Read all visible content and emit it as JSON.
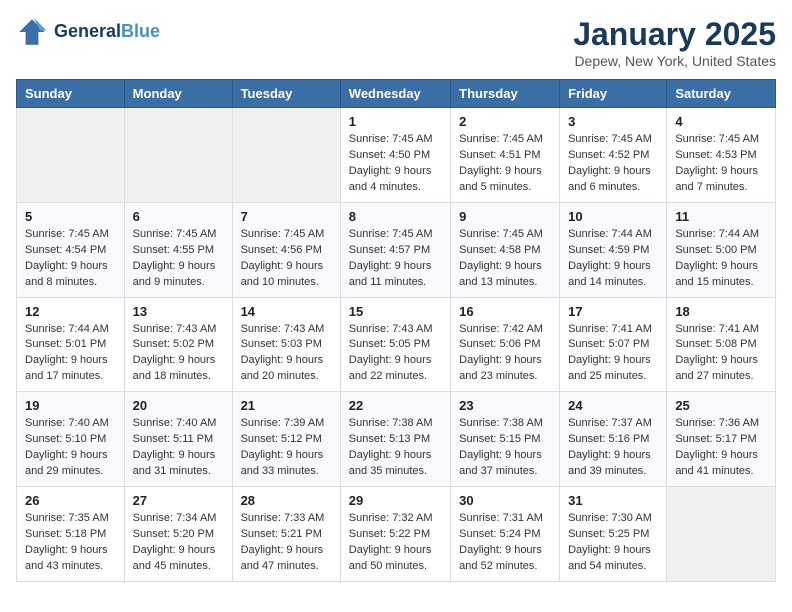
{
  "logo": {
    "line1": "General",
    "line2": "Blue"
  },
  "title": "January 2025",
  "location": "Depew, New York, United States",
  "weekdays": [
    "Sunday",
    "Monday",
    "Tuesday",
    "Wednesday",
    "Thursday",
    "Friday",
    "Saturday"
  ],
  "weeks": [
    [
      {
        "day": "",
        "text": ""
      },
      {
        "day": "",
        "text": ""
      },
      {
        "day": "",
        "text": ""
      },
      {
        "day": "1",
        "text": "Sunrise: 7:45 AM\nSunset: 4:50 PM\nDaylight: 9 hours and 4 minutes."
      },
      {
        "day": "2",
        "text": "Sunrise: 7:45 AM\nSunset: 4:51 PM\nDaylight: 9 hours and 5 minutes."
      },
      {
        "day": "3",
        "text": "Sunrise: 7:45 AM\nSunset: 4:52 PM\nDaylight: 9 hours and 6 minutes."
      },
      {
        "day": "4",
        "text": "Sunrise: 7:45 AM\nSunset: 4:53 PM\nDaylight: 9 hours and 7 minutes."
      }
    ],
    [
      {
        "day": "5",
        "text": "Sunrise: 7:45 AM\nSunset: 4:54 PM\nDaylight: 9 hours and 8 minutes."
      },
      {
        "day": "6",
        "text": "Sunrise: 7:45 AM\nSunset: 4:55 PM\nDaylight: 9 hours and 9 minutes."
      },
      {
        "day": "7",
        "text": "Sunrise: 7:45 AM\nSunset: 4:56 PM\nDaylight: 9 hours and 10 minutes."
      },
      {
        "day": "8",
        "text": "Sunrise: 7:45 AM\nSunset: 4:57 PM\nDaylight: 9 hours and 11 minutes."
      },
      {
        "day": "9",
        "text": "Sunrise: 7:45 AM\nSunset: 4:58 PM\nDaylight: 9 hours and 13 minutes."
      },
      {
        "day": "10",
        "text": "Sunrise: 7:44 AM\nSunset: 4:59 PM\nDaylight: 9 hours and 14 minutes."
      },
      {
        "day": "11",
        "text": "Sunrise: 7:44 AM\nSunset: 5:00 PM\nDaylight: 9 hours and 15 minutes."
      }
    ],
    [
      {
        "day": "12",
        "text": "Sunrise: 7:44 AM\nSunset: 5:01 PM\nDaylight: 9 hours and 17 minutes."
      },
      {
        "day": "13",
        "text": "Sunrise: 7:43 AM\nSunset: 5:02 PM\nDaylight: 9 hours and 18 minutes."
      },
      {
        "day": "14",
        "text": "Sunrise: 7:43 AM\nSunset: 5:03 PM\nDaylight: 9 hours and 20 minutes."
      },
      {
        "day": "15",
        "text": "Sunrise: 7:43 AM\nSunset: 5:05 PM\nDaylight: 9 hours and 22 minutes."
      },
      {
        "day": "16",
        "text": "Sunrise: 7:42 AM\nSunset: 5:06 PM\nDaylight: 9 hours and 23 minutes."
      },
      {
        "day": "17",
        "text": "Sunrise: 7:41 AM\nSunset: 5:07 PM\nDaylight: 9 hours and 25 minutes."
      },
      {
        "day": "18",
        "text": "Sunrise: 7:41 AM\nSunset: 5:08 PM\nDaylight: 9 hours and 27 minutes."
      }
    ],
    [
      {
        "day": "19",
        "text": "Sunrise: 7:40 AM\nSunset: 5:10 PM\nDaylight: 9 hours and 29 minutes."
      },
      {
        "day": "20",
        "text": "Sunrise: 7:40 AM\nSunset: 5:11 PM\nDaylight: 9 hours and 31 minutes."
      },
      {
        "day": "21",
        "text": "Sunrise: 7:39 AM\nSunset: 5:12 PM\nDaylight: 9 hours and 33 minutes."
      },
      {
        "day": "22",
        "text": "Sunrise: 7:38 AM\nSunset: 5:13 PM\nDaylight: 9 hours and 35 minutes."
      },
      {
        "day": "23",
        "text": "Sunrise: 7:38 AM\nSunset: 5:15 PM\nDaylight: 9 hours and 37 minutes."
      },
      {
        "day": "24",
        "text": "Sunrise: 7:37 AM\nSunset: 5:16 PM\nDaylight: 9 hours and 39 minutes."
      },
      {
        "day": "25",
        "text": "Sunrise: 7:36 AM\nSunset: 5:17 PM\nDaylight: 9 hours and 41 minutes."
      }
    ],
    [
      {
        "day": "26",
        "text": "Sunrise: 7:35 AM\nSunset: 5:18 PM\nDaylight: 9 hours and 43 minutes."
      },
      {
        "day": "27",
        "text": "Sunrise: 7:34 AM\nSunset: 5:20 PM\nDaylight: 9 hours and 45 minutes."
      },
      {
        "day": "28",
        "text": "Sunrise: 7:33 AM\nSunset: 5:21 PM\nDaylight: 9 hours and 47 minutes."
      },
      {
        "day": "29",
        "text": "Sunrise: 7:32 AM\nSunset: 5:22 PM\nDaylight: 9 hours and 50 minutes."
      },
      {
        "day": "30",
        "text": "Sunrise: 7:31 AM\nSunset: 5:24 PM\nDaylight: 9 hours and 52 minutes."
      },
      {
        "day": "31",
        "text": "Sunrise: 7:30 AM\nSunset: 5:25 PM\nDaylight: 9 hours and 54 minutes."
      },
      {
        "day": "",
        "text": ""
      }
    ]
  ]
}
